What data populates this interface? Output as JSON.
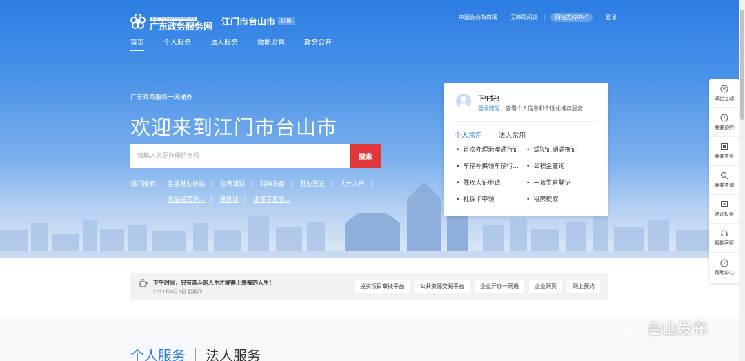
{
  "header": {
    "logo_small": "全国一体化在线政务服务平台",
    "logo_name": "广东政务服务网",
    "city": "江门市台山市",
    "switch_label": "切换",
    "top_links": [
      "中国台山政府网",
      "无障碍阅读",
      "网站支持IPv6",
      "登录"
    ]
  },
  "nav": [
    "首页",
    "个人服务",
    "法人服务",
    "效能监督",
    "政务公开"
  ],
  "hero": {
    "subtitle": "广东政务服务一网通办",
    "title": "欢迎来到江门市台山市",
    "search_placeholder": "请输入您要办理的事项",
    "search_button": "搜索",
    "hot_label": "热门搜索：",
    "hot_items": [
      "基层就业补贴",
      "生育津贴",
      "特种设备",
      "就业登记",
      "人才入户",
      "食品经营许...",
      "身份证",
      "烟草专卖零..."
    ]
  },
  "card": {
    "greeting": "下午好！",
    "login_link": "登录账号",
    "login_tail": "，查看个人信息和个性化推荐服务",
    "tabs": [
      "个人常用",
      "法人常用"
    ],
    "items": [
      "首次办理港澳通行证",
      "驾驶证期满换证",
      "车辆补换领车辆行...",
      "公积金查询",
      "残疾人证申请",
      "一孩生育登记",
      "社保卡申领",
      "租房提取"
    ]
  },
  "sidebar": [
    "政民互动",
    "我要预约",
    "我要查看",
    "我要查询",
    "咨询投诉",
    "智能客服",
    "帮助中心"
  ],
  "notice": {
    "title": "下午时间，只有奋斗的人生才称得上幸福的人生！",
    "date": "2021年8月5日 星期四",
    "quick_links": [
      "投资项目审批平台",
      "公共资源交易平台",
      "企业开办一网通",
      "企业网页",
      "网上预约"
    ]
  },
  "section": {
    "tabs": [
      "个人服务",
      "法人服务"
    ]
  },
  "watermark": "台山发布",
  "colors": {
    "brand_blue": "#2b7de3",
    "search_red": "#e0383a"
  }
}
